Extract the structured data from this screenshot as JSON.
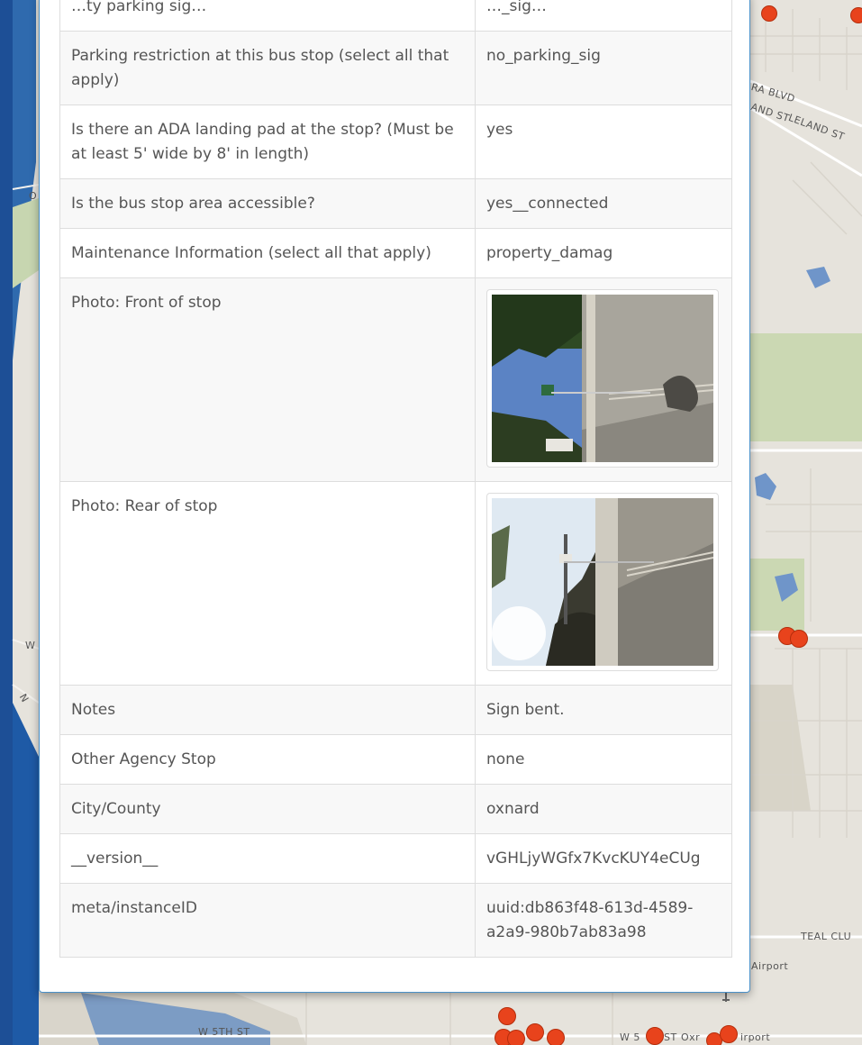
{
  "map": {
    "street_labels": [
      "RA BLVD",
      "AND ST",
      "LELAND ST",
      "W 5TH ST",
      "W 5",
      "ST",
      "Oxr",
      "irport",
      "Airport",
      "TEAL CLU",
      "W",
      "O",
      "N"
    ],
    "colors": {
      "land": "#e6e3dc",
      "park": "#c9d8b4",
      "water": "#7f9fc2",
      "ocean": "#1d5aa8",
      "marker": "#e8431c"
    }
  },
  "modal": {
    "rows": [
      {
        "key": "…ty parking sig…",
        "value": "…_sig…",
        "cut": true
      },
      {
        "key": "Parking restriction at this bus stop (select all that apply)",
        "value": "no_parking_sig"
      },
      {
        "key": "Is there an ADA landing pad at the stop? (Must be at least 5' wide by 8' in length)",
        "value": "yes"
      },
      {
        "key": "Is the bus stop area accessible?",
        "value": "yes__connected"
      },
      {
        "key": "Maintenance Information (select all that apply)",
        "value": "property_damag"
      },
      {
        "key": "Photo: Front of stop",
        "photo": "front-of-stop-photo"
      },
      {
        "key": "Photo: Rear of stop",
        "photo": "rear-of-stop-photo"
      },
      {
        "key": "Notes",
        "value": "Sign bent."
      },
      {
        "key": "Other Agency Stop",
        "value": "none"
      },
      {
        "key": "City/County",
        "value": "oxnard"
      },
      {
        "key": "__version__",
        "value": "vGHLjyWGfx7KvcKUY4eCUg"
      },
      {
        "key": "meta/instanceID",
        "value": "uuid:db863f48-613d-4589-a2a9-980b7ab83a98"
      }
    ]
  }
}
